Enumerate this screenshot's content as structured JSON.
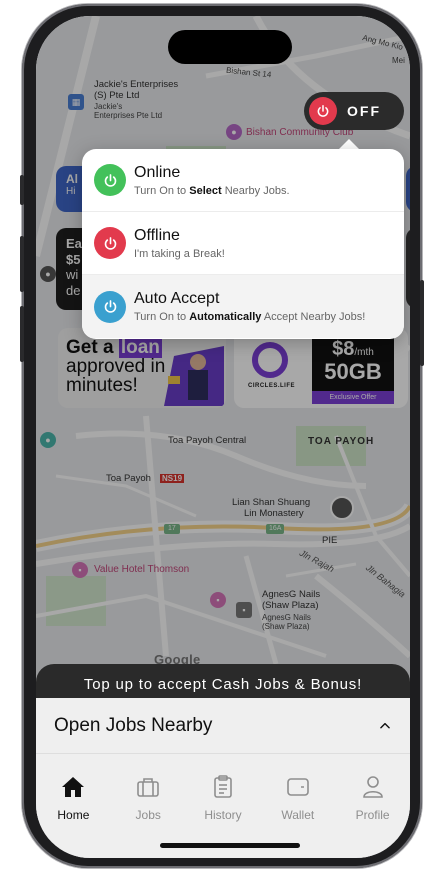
{
  "status_toggle": {
    "label": "OFF",
    "knob_color": "#e23a4d",
    "icon": "power-icon"
  },
  "status_menu": {
    "items": [
      {
        "title": "Online",
        "subtitle_prefix": "Turn On to ",
        "subtitle_bold": "Select",
        "subtitle_suffix": " Nearby Jobs.",
        "color": "#43c15a",
        "icon": "power-icon"
      },
      {
        "title": "Offline",
        "subtitle_prefix": "I'm taking a Break!",
        "subtitle_bold": "",
        "subtitle_suffix": "",
        "color": "#e23a4d",
        "icon": "power-icon"
      },
      {
        "title": "Auto Accept",
        "subtitle_prefix": "Turn On to ",
        "subtitle_bold": "Automatically",
        "subtitle_suffix": " Accept Nearby Jobs!",
        "color": "#3aa0cf",
        "icon": "power-icon"
      }
    ]
  },
  "map": {
    "labels": {
      "bishan_st": "Bishan St 14",
      "ang_mo_kio": "Ang Mo Kio",
      "mei": "Mei",
      "jackies_1": "Jackie's Enterprises",
      "jackies_2": "(S) Pte Ltd",
      "jackies_3": "Jackie's",
      "jackies_4": "Enterprises Pte Ltd",
      "bishan_cc": "Bishan Community Club",
      "toa_payoh_central": "Toa Payoh Central",
      "toa_payoh_caps": "TOA PAYOH",
      "toa_payoh": "Toa Payoh",
      "ns19": "NS19",
      "lian_shan_1": "Lian Shan Shuang",
      "lian_shan_2": "Lin Monastery",
      "pie": "PIE",
      "pie_17": "17",
      "pie_16a": "16A",
      "jln_rajah": "Jln Rajah",
      "jln_bahagia": "Jln Bahagia",
      "value_hotel": "Value Hotel Thomson",
      "agnesg_1": "AgnesG Nails",
      "agnesg_2": "(Shaw Plaza)",
      "agnesg_3": "AgnesG Nails",
      "agnesg_4": "(Shaw Plaza)",
      "google": "Google"
    }
  },
  "promo_left": {
    "line1": "Ea",
    "line2": "$5",
    "line3": "wi",
    "line4": "de",
    "al": "Al",
    "hi": "Hi"
  },
  "promo_loan": {
    "part1": "Get a ",
    "highlight": "loan",
    "line2": "approved in",
    "line3": "minutes!"
  },
  "promo_circles": {
    "brand": "CIRCLES.LIFE",
    "price": "$8",
    "per": "/mth",
    "data": "50GB",
    "tag": "Exclusive Offer"
  },
  "topup_banner": "Top up to accept Cash Jobs & Bonus!",
  "jobs_sheet": {
    "title": "Open Jobs Nearby"
  },
  "bottom_nav": {
    "items": [
      {
        "label": "Home",
        "icon": "home-icon",
        "active": true
      },
      {
        "label": "Jobs",
        "icon": "briefcase-icon",
        "active": false
      },
      {
        "label": "History",
        "icon": "clipboard-icon",
        "active": false
      },
      {
        "label": "Wallet",
        "icon": "wallet-icon",
        "active": false
      },
      {
        "label": "Profile",
        "icon": "user-icon",
        "active": false
      }
    ]
  }
}
